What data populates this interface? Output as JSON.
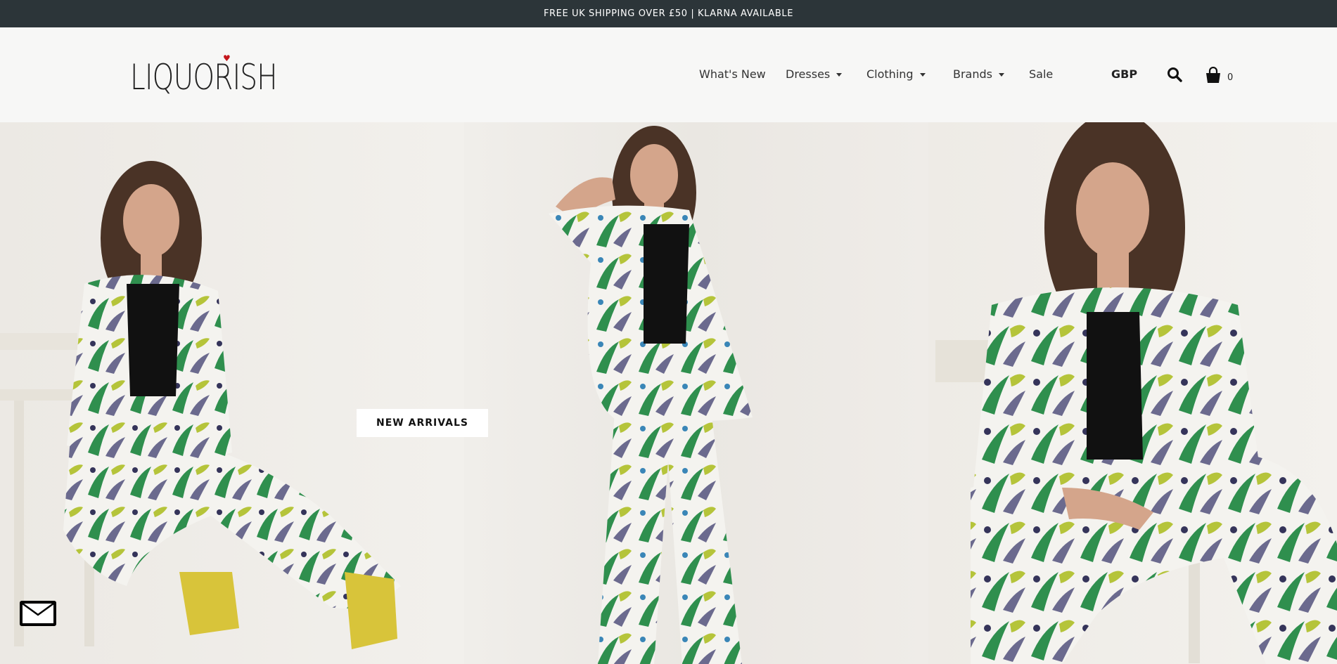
{
  "announcement": "FREE UK SHIPPING OVER £50 | KLARNA AVAILABLE",
  "brand": {
    "logo_text": "LIQUORISH",
    "heart_color": "#c4161c"
  },
  "nav": {
    "items": [
      {
        "label": "What's New",
        "has_dropdown": false
      },
      {
        "label": "Dresses",
        "has_dropdown": true
      },
      {
        "label": "Clothing",
        "has_dropdown": true
      },
      {
        "label": "Brands",
        "has_dropdown": true
      },
      {
        "label": "Sale",
        "has_dropdown": false
      }
    ],
    "currency": "GBP",
    "cart_count": "0"
  },
  "hero": {
    "cta_label": "NEW ARRIVALS"
  },
  "icons": {
    "search": "search-icon",
    "cart": "shopping-bag-icon",
    "mail": "envelope-icon"
  },
  "colors": {
    "topbar_bg": "#2c3539",
    "header_bg": "#f7f7f6"
  }
}
